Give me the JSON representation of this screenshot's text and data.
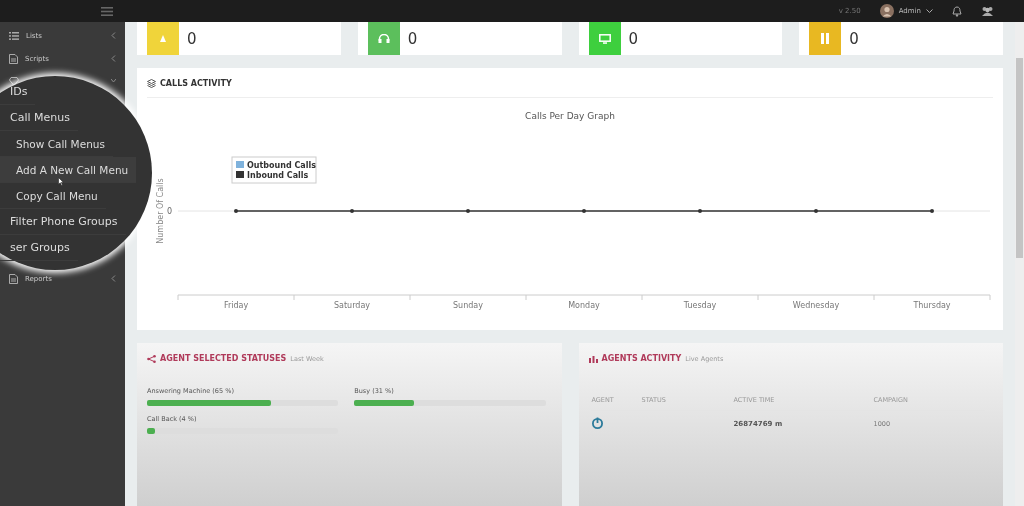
{
  "topbar": {
    "version": "v 2.50",
    "user": "Admin"
  },
  "sidebar": {
    "items": [
      {
        "label": "Lists",
        "kind": "list"
      },
      {
        "label": "Scripts",
        "kind": "script"
      },
      {
        "kind": "diamond"
      },
      {
        "label": "Reports",
        "kind": "report"
      }
    ]
  },
  "magnifier": {
    "items": [
      {
        "label": "IDs",
        "kind": "top"
      },
      {
        "label": "Call Menus",
        "kind": "top"
      },
      {
        "label": "Show Call Menus",
        "kind": "sub"
      },
      {
        "label": "Add A New Call Menu",
        "kind": "sub",
        "hovered": true
      },
      {
        "label": "Copy Call Menu",
        "kind": "sub"
      },
      {
        "label": "Filter Phone Groups",
        "kind": "top"
      },
      {
        "label": "ser Groups",
        "kind": "top"
      }
    ]
  },
  "stats": [
    {
      "kind": "bell",
      "color": "#f0d43a",
      "value": "0"
    },
    {
      "kind": "headset",
      "color": "#5cbf5c",
      "value": "0"
    },
    {
      "kind": "monitor",
      "color": "#3ecf3e",
      "value": "0"
    },
    {
      "kind": "pause",
      "color": "#e8b822",
      "value": "0"
    }
  ],
  "calls_activity": {
    "title": "CALLS ACTIVITY",
    "graph": {
      "title": "Calls Per Day Graph",
      "y_label": "Number Of Calls",
      "y_tick": "0",
      "x_labels": [
        "Friday",
        "Saturday",
        "Sunday",
        "Monday",
        "Tuesday",
        "Wednesday",
        "Thursday"
      ],
      "legend": [
        {
          "name": "Outbound Calls",
          "color": "#7fb2dc"
        },
        {
          "name": "Inbound Calls",
          "color": "#333333"
        }
      ]
    }
  },
  "agent_statuses": {
    "title": "AGENT SELECTED STATUSES",
    "subtitle": "Last Week",
    "items": [
      {
        "label": "Answering Machine (65 %)",
        "level": 0.65
      },
      {
        "label": "Busy (31 %)",
        "level": 0.31
      },
      {
        "label": "Call Back (4 %)",
        "level": 0.04
      }
    ]
  },
  "agents_activity": {
    "title": "AGENTS ACTIVITY",
    "subtitle": "Live Agents",
    "columns": [
      "AGENT",
      "STATUS",
      "ACTIVE TIME",
      "CAMPAIGN"
    ],
    "rows": [
      {
        "active_time": "26874769 m",
        "campaign": "1000"
      }
    ]
  }
}
